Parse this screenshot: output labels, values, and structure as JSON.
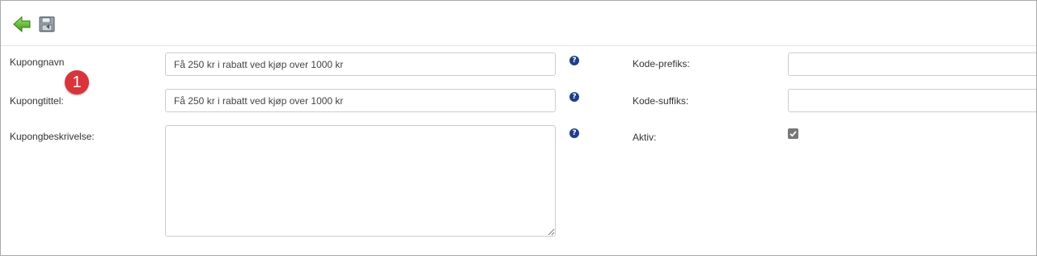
{
  "toolbar": {
    "back_icon": "back-arrow-icon",
    "save_icon": "save-disk-icon"
  },
  "form": {
    "name": {
      "label": "Kupongnavn",
      "value": "Få 250 kr i rabatt ved kjøp over 1000 kr"
    },
    "title": {
      "label": "Kupongtittel:",
      "value": "Få 250 kr i rabatt ved kjøp over 1000 kr"
    },
    "description": {
      "label": "Kupongbeskrivelse:",
      "value": ""
    },
    "prefix": {
      "label": "Kode-prefiks:",
      "value": ""
    },
    "suffix": {
      "label": "Kode-suffiks:",
      "value": ""
    },
    "active": {
      "label": "Aktiv:",
      "checked": true
    },
    "help_glyph": "?"
  },
  "callout": {
    "number": "1",
    "color": "#d9343a"
  }
}
